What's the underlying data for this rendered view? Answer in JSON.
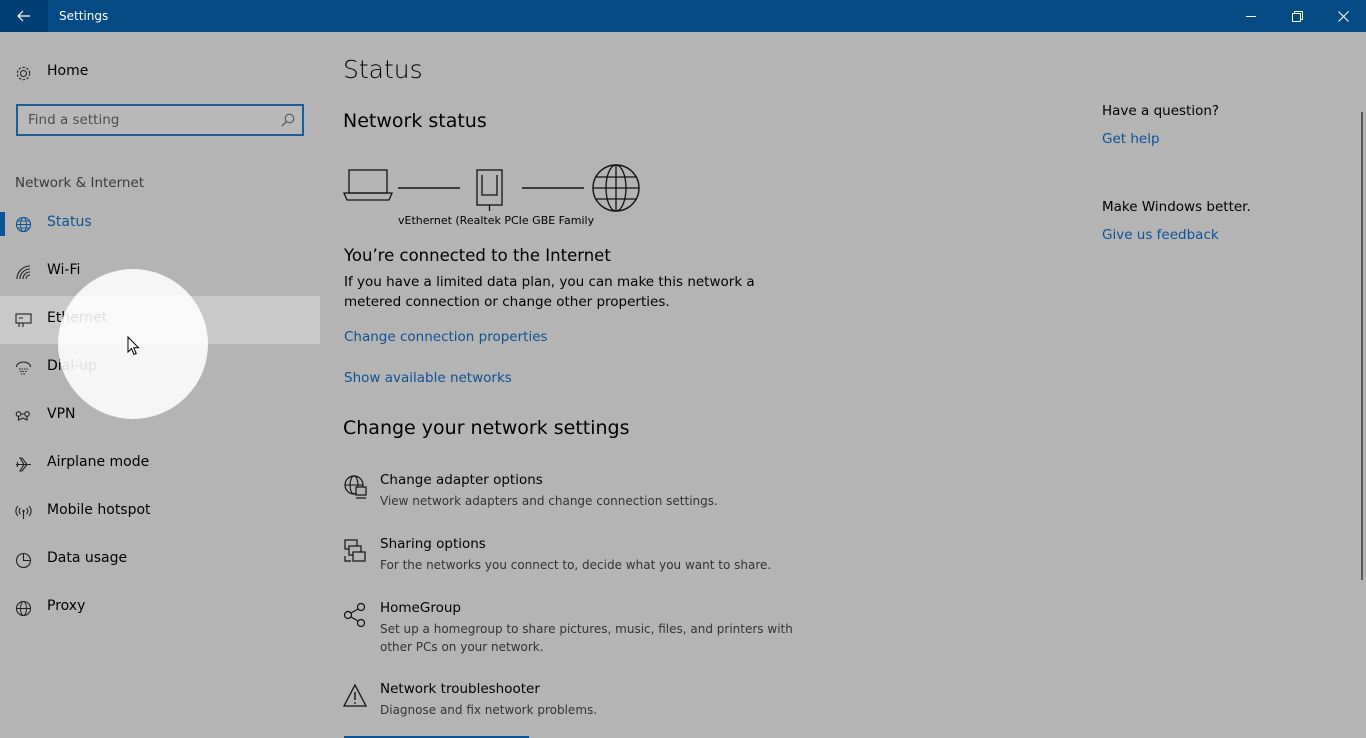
{
  "window": {
    "title": "Settings"
  },
  "sidebar": {
    "home_label": "Home",
    "search_placeholder": "Find a setting",
    "section_title": "Network & Internet",
    "items": [
      {
        "label": "Status",
        "icon": "globe-icon",
        "active": true
      },
      {
        "label": "Wi-Fi",
        "icon": "wifi-icon"
      },
      {
        "label": "Ethernet",
        "icon": "ethernet-icon",
        "hover": true
      },
      {
        "label": "Dial-up",
        "icon": "dialup-icon"
      },
      {
        "label": "VPN",
        "icon": "vpn-icon"
      },
      {
        "label": "Airplane mode",
        "icon": "airplane-icon"
      },
      {
        "label": "Mobile hotspot",
        "icon": "hotspot-icon"
      },
      {
        "label": "Data usage",
        "icon": "data-usage-icon"
      },
      {
        "label": "Proxy",
        "icon": "proxy-icon"
      }
    ]
  },
  "main": {
    "title": "Status",
    "network_status_heading": "Network status",
    "adapter_name": "vEthernet (Realtek PCIe GBE Family",
    "connected_text": "You’re connected to the Internet",
    "connected_desc": "If you have a limited data plan, you can make this network a metered connection or change other properties.",
    "link_change_properties": "Change connection properties",
    "link_show_networks": "Show available networks",
    "change_settings_heading": "Change your network settings",
    "options": [
      {
        "title": "Change adapter options",
        "desc": "View network adapters and change connection settings.",
        "icon": "adapter-icon"
      },
      {
        "title": "Sharing options",
        "desc": "For the networks you connect to, decide what you want to share.",
        "icon": "sharing-icon"
      },
      {
        "title": "HomeGroup",
        "desc": "Set up a homegroup to share pictures, music, files, and printers with other PCs on your network.",
        "icon": "homegroup-icon"
      },
      {
        "title": "Network troubleshooter",
        "desc": "Diagnose and fix network problems.",
        "icon": "warning-icon"
      }
    ]
  },
  "right": {
    "question_heading": "Have a question?",
    "get_help": "Get help",
    "better_heading": "Make Windows better.",
    "feedback": "Give us feedback"
  },
  "colors": {
    "titlebar": "#044a84",
    "accent": "#0b5396",
    "background": "#b4b4b4"
  }
}
